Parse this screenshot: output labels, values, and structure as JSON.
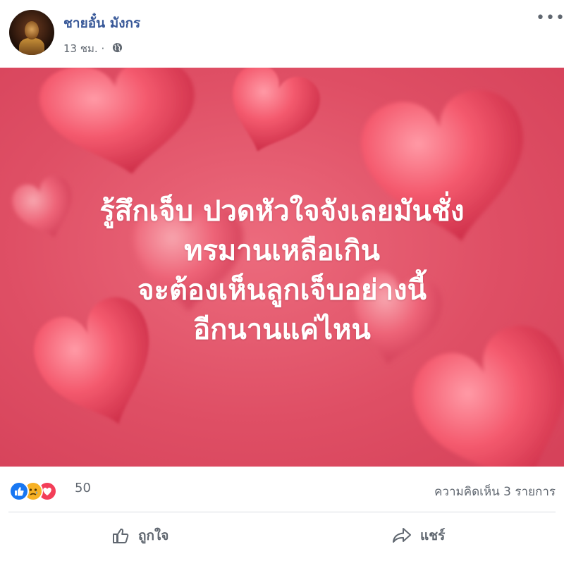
{
  "post": {
    "author": "ชายอั๋น มังกร",
    "time": "13 ชม. ·",
    "privacy_icon": "globe-icon"
  },
  "image": {
    "background_color": "#df4f65",
    "caption_lines": [
      "รู้สึกเจ็บ ปวดหัวใจจังเลยมันชั่ง",
      "ทรมานเหลือเกิน",
      "จะต้องเห็นลูกเจ็บอย่างนี้",
      "อีกนานแค่ไหน"
    ]
  },
  "stats": {
    "reaction_icons": [
      "like-icon",
      "sad-icon",
      "love-icon"
    ],
    "reaction_count": "50",
    "comment_count": "ความคิดเห็น 3 รายการ"
  },
  "actions": {
    "like_label": "ถูกใจ",
    "share_label": "แชร์"
  },
  "colors": {
    "author_link": "#385898",
    "secondary_text": "#606770",
    "like_blue": "#1877f2",
    "love_red": "#f33e58",
    "sad_yellow": "#f7b125"
  }
}
